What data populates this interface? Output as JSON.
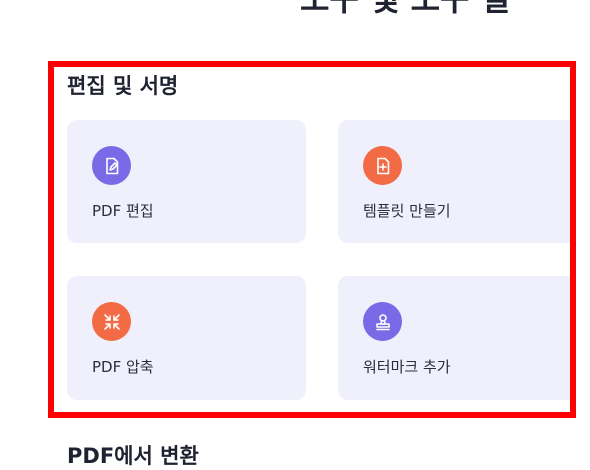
{
  "header": {
    "clipped_title": "도구 및 도구 설"
  },
  "section": {
    "title": "편집 및 서명",
    "cards": [
      {
        "label": "PDF 편집",
        "icon": "pdf-edit-icon",
        "icon_color": "#7b6ae8"
      },
      {
        "label": "템플릿 만들기",
        "icon": "add-file-icon",
        "icon_color": "#f26b45"
      },
      {
        "label": "PDF 압축",
        "icon": "compress-icon",
        "icon_color": "#f26b45"
      },
      {
        "label": "워터마크 추가",
        "icon": "stamp-icon",
        "icon_color": "#7b6ae8"
      }
    ]
  },
  "next_section": {
    "title": "PDF에서 변환"
  },
  "colors": {
    "highlight": "#ff0000",
    "card_bg": "#eff0fc"
  }
}
